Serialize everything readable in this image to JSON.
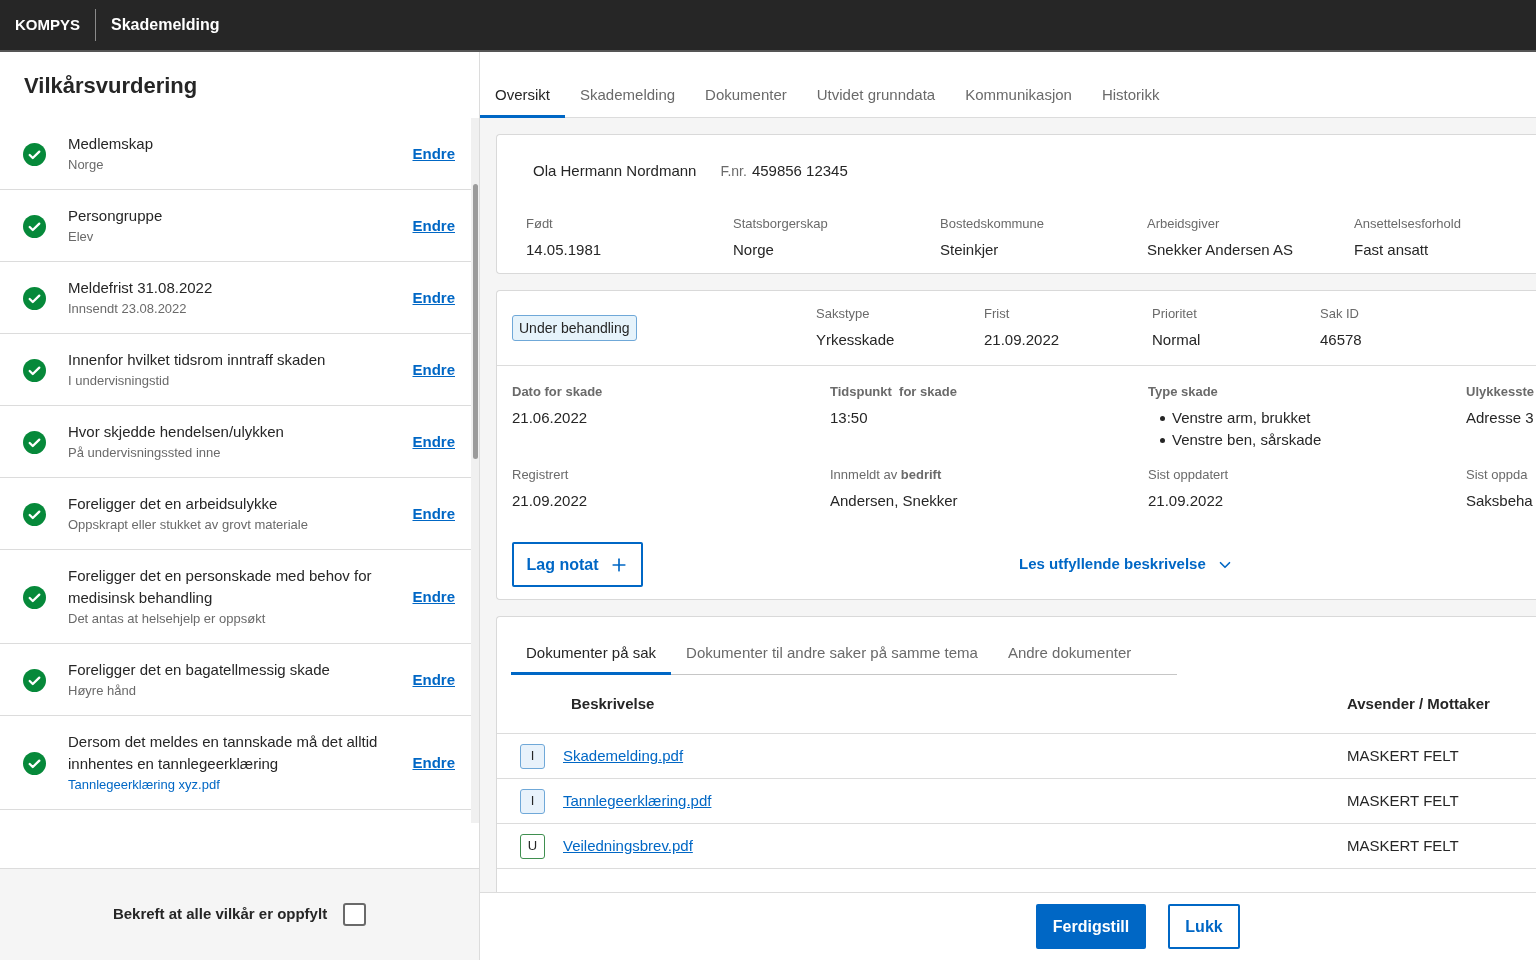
{
  "header": {
    "brand": "KOMPYS",
    "title": "Skademelding"
  },
  "conditions": {
    "title": "Vilkårsvurdering",
    "items": [
      {
        "title": "Medlemskap",
        "detail": {
          "kind": "text",
          "text": "Norge"
        },
        "fulfilled": true,
        "action": "Endre"
      },
      {
        "title": "Persongruppe",
        "detail": {
          "kind": "text",
          "text": "Elev"
        },
        "fulfilled": true,
        "action": "Endre"
      },
      {
        "title": "Meldefrist 31.08.2022",
        "detail": {
          "kind": "text",
          "text": "Innsendt 23.08.2022"
        },
        "fulfilled": true,
        "action": "Endre"
      },
      {
        "title": "Innenfor hvilket tidsrom inntraff skaden",
        "detail": {
          "kind": "text",
          "text": "I undervisningstid"
        },
        "fulfilled": true,
        "action": "Endre"
      },
      {
        "title": "Hvor skjedde hendelsen/ulykken",
        "detail": {
          "kind": "text",
          "text": "På undervisningssted inne"
        },
        "fulfilled": true,
        "action": "Endre"
      },
      {
        "title": "Foreligger det en arbeidsulykke",
        "detail": {
          "kind": "text",
          "text": "Oppskrapt eller stukket av grovt materiale"
        },
        "fulfilled": true,
        "action": "Endre"
      },
      {
        "title": "Foreligger det en personskade med behov for medisinsk behandling",
        "detail": {
          "kind": "text",
          "text": "Det antas at helsehjelp er oppsøkt"
        },
        "fulfilled": true,
        "action": "Endre"
      },
      {
        "title": "Foreligger det en bagatellmessig skade",
        "detail": {
          "kind": "text",
          "text": "Høyre hånd"
        },
        "fulfilled": true,
        "action": "Endre"
      },
      {
        "title": "Dersom det meldes en tannskade må det alltid innhentes en tannlegeerklæring",
        "detail": {
          "kind": "link",
          "text": "Tannlegeerklæring xyz.pdf"
        },
        "fulfilled": true,
        "action": "Endre"
      }
    ],
    "confirm": {
      "label": "Bekreft at alle vilkår er oppfylt",
      "checked": false
    }
  },
  "tabs": [
    {
      "label": "Oversikt",
      "selected": true
    },
    {
      "label": "Skademelding",
      "selected": false
    },
    {
      "label": "Dokumenter",
      "selected": false
    },
    {
      "label": "Utvidet grunndata",
      "selected": false
    },
    {
      "label": "Kommunikasjon",
      "selected": false
    },
    {
      "label": "Historikk",
      "selected": false
    }
  ],
  "person": {
    "name": "Ola Hermann Nordmann",
    "id_label": "F.nr.",
    "id_value": "459856 12345",
    "fields": [
      {
        "label": "Født",
        "value": "14.05.1981"
      },
      {
        "label": "Statsborgerskap",
        "value": "Norge"
      },
      {
        "label": "Bostedskommune",
        "value": "Steinkjer"
      },
      {
        "label": "Arbeidsgiver",
        "value": "Snekker Andersen AS"
      },
      {
        "label": "Ansettelsesforhold",
        "value": "Fast ansatt"
      }
    ]
  },
  "case": {
    "status": "Under behandling",
    "fields": [
      {
        "label": "Sakstype",
        "value": "Yrkesskade"
      },
      {
        "label": "Frist",
        "value": "21.09.2022"
      },
      {
        "label": "Prioritet",
        "value": "Normal"
      },
      {
        "label": "Sak ID",
        "value": "46578"
      }
    ],
    "details": [
      {
        "label_bold": true,
        "fields": [
          {
            "label": "Dato for skade",
            "kind": "text",
            "value": "21.06.2022"
          },
          {
            "label": "Tidspunkt  for skade",
            "kind": "text",
            "value": "13:50"
          },
          {
            "label": "Type skade",
            "kind": "list",
            "values": [
              "Venstre arm, brukket",
              "Venstre ben, sårskade"
            ]
          },
          {
            "label": "Ulykkesste",
            "kind": "text",
            "value": "Adresse 3"
          }
        ]
      },
      {
        "label_bold": false,
        "fields": [
          {
            "label": "Registrert",
            "kind": "text",
            "value": "21.09.2022"
          },
          {
            "label": "Innmeldt av **bedrift**",
            "kind": "text",
            "value": "Andersen, Snekker"
          },
          {
            "label": "Sist oppdatert",
            "kind": "text",
            "value": "21.09.2022"
          },
          {
            "label": "Sist oppda",
            "kind": "text",
            "value": "Saksbeha"
          }
        ]
      }
    ],
    "note_button": "Lag notat",
    "expand_link": "Les utfyllende beskrivelse"
  },
  "documents": {
    "tabs": [
      {
        "label": "Dokumenter på sak",
        "selected": true
      },
      {
        "label": "Dokumenter til andre saker på samme tema",
        "selected": false
      },
      {
        "label": "Andre dokumenter",
        "selected": false
      }
    ],
    "columns": [
      "Beskrivelse",
      "Avsender / Mottaker"
    ],
    "rows": [
      {
        "badge": "I",
        "kind": "incoming",
        "color": "#6fa8d8",
        "file": "Skademelding.pdf",
        "party": "MASKERT FELT"
      },
      {
        "badge": "I",
        "kind": "incoming",
        "color": "#6fa8d8",
        "file": "Tannlegeerklæring.pdf",
        "party": "MASKERT FELT"
      },
      {
        "badge": "U",
        "kind": "outgoing",
        "color": "#3f8f4f",
        "file": "Veiledningsbrev.pdf",
        "party": "MASKERT FELT"
      }
    ]
  },
  "actions": [
    {
      "label": "Ferdigstill",
      "kind": "primary"
    },
    {
      "label": "Lukk",
      "kind": "secondary"
    }
  ]
}
